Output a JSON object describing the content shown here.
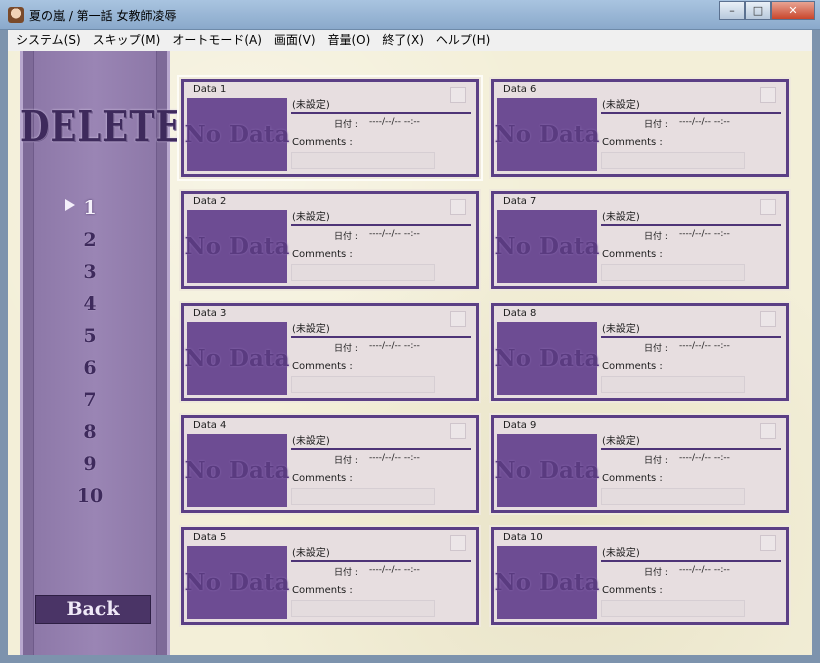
{
  "window": {
    "title": "夏の嵐 / 第一話 女教師凌辱",
    "minimize": "–",
    "maximize": "□",
    "close": "✕"
  },
  "menu": [
    {
      "label": "システム(S)"
    },
    {
      "label": "スキップ(M)"
    },
    {
      "label": "オートモード(A)"
    },
    {
      "label": "画面(V)"
    },
    {
      "label": "音量(O)"
    },
    {
      "label": "終了(X)"
    },
    {
      "label": "ヘルプ(H)"
    }
  ],
  "sidebar": {
    "title": "DELETE",
    "pages": [
      "1",
      "2",
      "3",
      "4",
      "5",
      "6",
      "7",
      "8",
      "9",
      "10"
    ],
    "active_page": "1",
    "back_label": "Back"
  },
  "slot_text": {
    "thumbnail": "No Data",
    "unset": "(未設定)",
    "date_label": "日付 :",
    "date_value": "----/--/-- --:--",
    "comments_label": "Comments :"
  },
  "slots": [
    {
      "name": "Data 1"
    },
    {
      "name": "Data 2"
    },
    {
      "name": "Data 3"
    },
    {
      "name": "Data 4"
    },
    {
      "name": "Data 5"
    },
    {
      "name": "Data 6"
    },
    {
      "name": "Data 7"
    },
    {
      "name": "Data 8"
    },
    {
      "name": "Data 9"
    },
    {
      "name": "Data 10"
    }
  ],
  "colors": {
    "accent": "#5b3f85",
    "sidebar": "#8d78a8",
    "background": "#f3efd8"
  }
}
